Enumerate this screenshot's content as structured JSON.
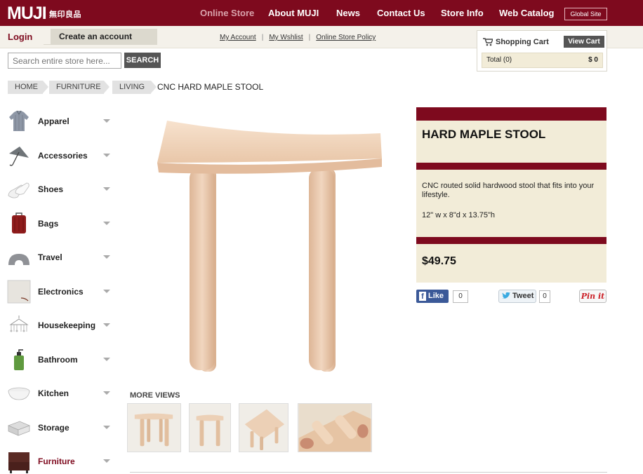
{
  "header": {
    "logo": "MUJI",
    "logo_sub": "無印良品",
    "nav": [
      "Online Store",
      "About MUJI",
      "News",
      "Contact Us",
      "Store Info",
      "Web Catalog"
    ],
    "global_site": "Global Site"
  },
  "subheader": {
    "login": "Login",
    "create_account": "Create an account",
    "links": [
      "My Account",
      "My Wshlist",
      "Online Store Policy"
    ]
  },
  "cart": {
    "title": "Shopping Cart",
    "view_cart": "View Cart",
    "total_label": "Total (0)",
    "total_amount": "$ 0"
  },
  "search": {
    "placeholder": "Search entire store here...",
    "button": "SEARCH"
  },
  "breadcrumb": {
    "items": [
      "HOME",
      "FURNITURE",
      "LIVING"
    ],
    "current": "CNC HARD MAPLE STOOL"
  },
  "sidebar": {
    "categories": [
      {
        "label": "Apparel",
        "icon": "shirt-icon"
      },
      {
        "label": "Accessories",
        "icon": "umbrella-icon"
      },
      {
        "label": "Shoes",
        "icon": "shoes-icon"
      },
      {
        "label": "Bags",
        "icon": "suitcase-icon"
      },
      {
        "label": "Travel",
        "icon": "neck-pillow-icon"
      },
      {
        "label": "Electronics",
        "icon": "speaker-icon"
      },
      {
        "label": "Housekeeping",
        "icon": "hanger-icon"
      },
      {
        "label": "Bathroom",
        "icon": "soap-bottle-icon"
      },
      {
        "label": "Kitchen",
        "icon": "bowl-icon"
      },
      {
        "label": "Storage",
        "icon": "storage-box-icon"
      },
      {
        "label": "Furniture",
        "icon": "sofa-icon",
        "active": true
      }
    ]
  },
  "product": {
    "title": "HARD MAPLE STOOL",
    "description": "CNC routed solid hardwood stool that fits into your lifestyle.",
    "dimensions": "12\" w x 8\"d x 13.75\"h",
    "price": "$49.75"
  },
  "social": {
    "like_label": "Like",
    "like_count": "0",
    "tweet_label": "Tweet",
    "tweet_count": "0",
    "pin_label": "Pin it"
  },
  "more_views": {
    "title": "MORE VIEWS"
  },
  "colors": {
    "brand": "#7e0a1e",
    "panel": "#f2ecd8",
    "facebook": "#3b5998",
    "pinterest": "#cb2027"
  }
}
